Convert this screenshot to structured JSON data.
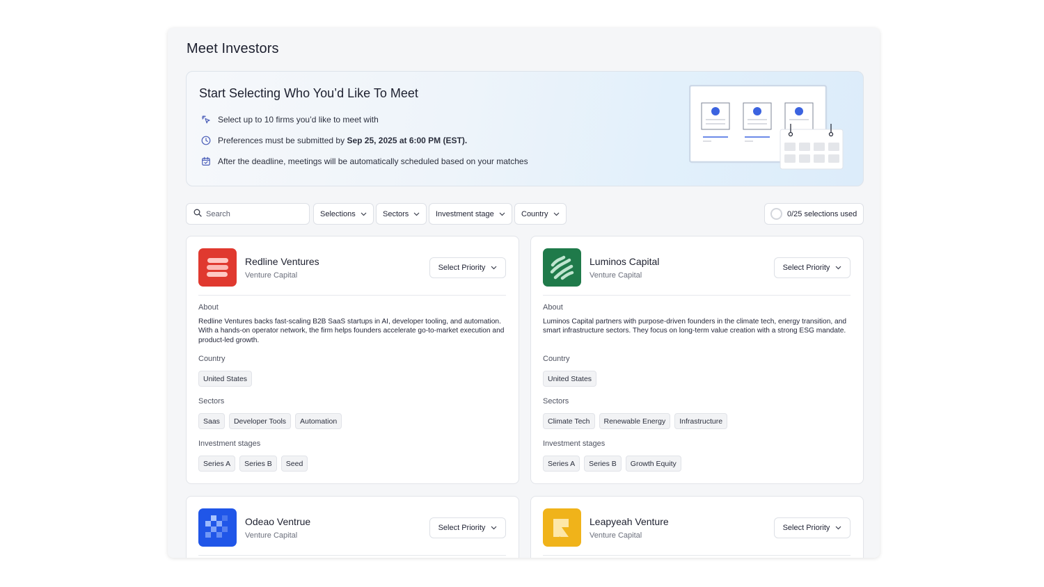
{
  "page": {
    "title": "Meet Investors"
  },
  "banner": {
    "title": "Start Selecting Who You’d Like To Meet",
    "line1": "Select up to 10 firms you’d like to meet with",
    "line2_prefix": "Preferences must be submitted by ",
    "line2_bold": "Sep 25, 2025 at 6:00 PM (EST).",
    "line3": "After the deadline, meetings will be automatically scheduled based on your matches"
  },
  "filters": {
    "search_placeholder": "Search",
    "selections": "Selections",
    "sectors": "Sectors",
    "investment_stage": "Investment stage",
    "country": "Country",
    "selections_used": "0/25 selections used"
  },
  "labels": {
    "about": "About",
    "country": "Country",
    "sectors": "Sectors",
    "stages": "Investment stages",
    "select_priority": "Select Priority"
  },
  "colors": {
    "accent_blue": "#3b63e0",
    "redline": "#e0392f",
    "luminos": "#1f7a4a",
    "odeao": "#2056e8",
    "leapyeah": "#f0b31a"
  },
  "investors": [
    {
      "name": "Redline Ventures",
      "type": "Venture Capital",
      "about": "Redline Ventures backs fast-scaling B2B SaaS startups in AI, developer tooling, and automation. With a hands-on operator network, the firm helps founders accelerate go-to-market execution and product-led growth.",
      "country": "United States",
      "sectors": [
        "Saas",
        "Developer Tools",
        "Automation"
      ],
      "stages": [
        "Series A",
        "Series B",
        "Seed"
      ]
    },
    {
      "name": "Luminos Capital",
      "type": "Venture Capital",
      "about": "Luminos Capital partners with purpose-driven founders in the climate tech, energy transition, and smart infrastructure sectors. They focus on long-term value creation with a strong ESG mandate.",
      "country": "United States",
      "sectors": [
        "Climate Tech",
        "Renewable Energy",
        "Infrastructure"
      ],
      "stages": [
        "Series A",
        "Series B",
        "Growth Equity"
      ]
    },
    {
      "name": "Odeao Ventrue",
      "type": "Venture Capital"
    },
    {
      "name": "Leapyeah Venture",
      "type": "Venture Capital"
    }
  ]
}
